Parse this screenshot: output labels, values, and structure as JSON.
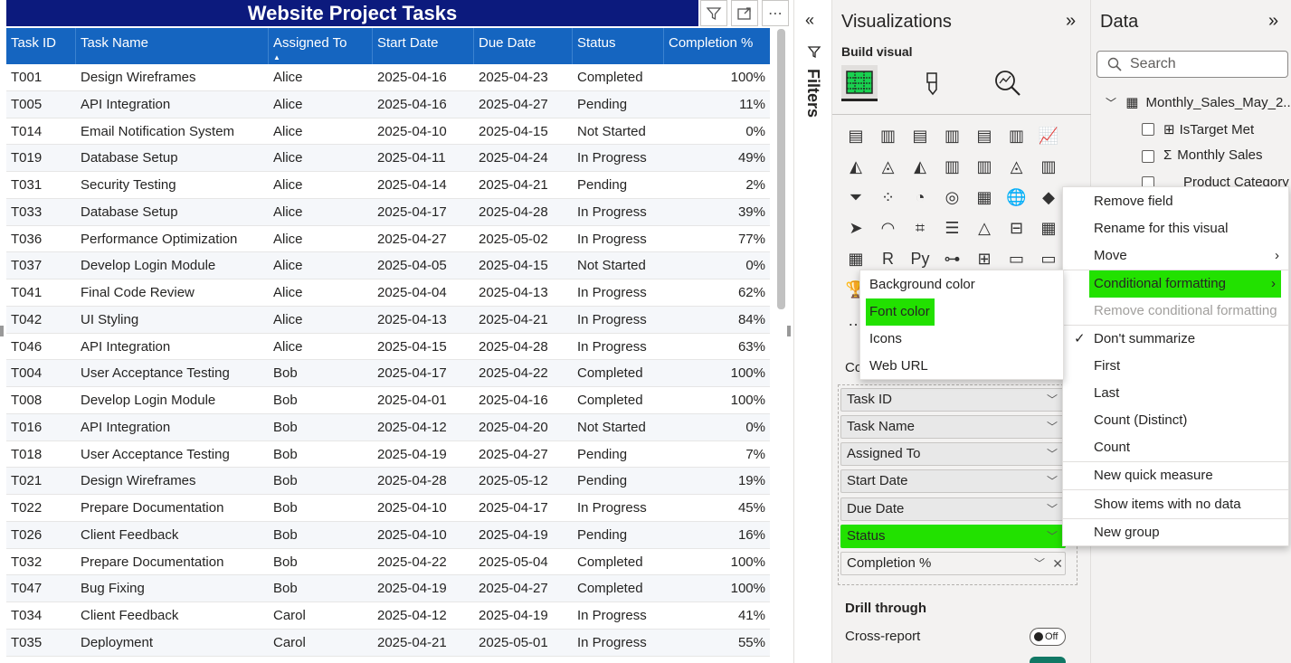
{
  "visual": {
    "title": "Website Project Tasks",
    "columns": [
      "Task ID",
      "Task Name",
      "Assigned To",
      "Start Date",
      "Due Date",
      "Status",
      "Completion %"
    ],
    "rows": [
      [
        "T001",
        "Design Wireframes",
        "Alice",
        "2025-04-16",
        "2025-04-23",
        "Completed",
        "100%"
      ],
      [
        "T005",
        "API Integration",
        "Alice",
        "2025-04-16",
        "2025-04-27",
        "Pending",
        "11%"
      ],
      [
        "T014",
        "Email Notification System",
        "Alice",
        "2025-04-10",
        "2025-04-15",
        "Not Started",
        "0%"
      ],
      [
        "T019",
        "Database Setup",
        "Alice",
        "2025-04-11",
        "2025-04-24",
        "In Progress",
        "49%"
      ],
      [
        "T031",
        "Security Testing",
        "Alice",
        "2025-04-14",
        "2025-04-21",
        "Pending",
        "2%"
      ],
      [
        "T033",
        "Database Setup",
        "Alice",
        "2025-04-17",
        "2025-04-28",
        "In Progress",
        "39%"
      ],
      [
        "T036",
        "Performance Optimization",
        "Alice",
        "2025-04-27",
        "2025-05-02",
        "In Progress",
        "77%"
      ],
      [
        "T037",
        "Develop Login Module",
        "Alice",
        "2025-04-05",
        "2025-04-15",
        "Not Started",
        "0%"
      ],
      [
        "T041",
        "Final Code Review",
        "Alice",
        "2025-04-04",
        "2025-04-13",
        "In Progress",
        "62%"
      ],
      [
        "T042",
        "UI Styling",
        "Alice",
        "2025-04-13",
        "2025-04-21",
        "In Progress",
        "84%"
      ],
      [
        "T046",
        "API Integration",
        "Alice",
        "2025-04-15",
        "2025-04-28",
        "In Progress",
        "63%"
      ],
      [
        "T004",
        "User Acceptance Testing",
        "Bob",
        "2025-04-17",
        "2025-04-22",
        "Completed",
        "100%"
      ],
      [
        "T008",
        "Develop Login Module",
        "Bob",
        "2025-04-01",
        "2025-04-16",
        "Completed",
        "100%"
      ],
      [
        "T016",
        "API Integration",
        "Bob",
        "2025-04-12",
        "2025-04-20",
        "Not Started",
        "0%"
      ],
      [
        "T018",
        "User Acceptance Testing",
        "Bob",
        "2025-04-19",
        "2025-04-27",
        "Pending",
        "7%"
      ],
      [
        "T021",
        "Design Wireframes",
        "Bob",
        "2025-04-28",
        "2025-05-12",
        "Pending",
        "19%"
      ],
      [
        "T022",
        "Prepare Documentation",
        "Bob",
        "2025-04-10",
        "2025-04-17",
        "In Progress",
        "45%"
      ],
      [
        "T026",
        "Client Feedback",
        "Bob",
        "2025-04-10",
        "2025-04-19",
        "Pending",
        "16%"
      ],
      [
        "T032",
        "Prepare Documentation",
        "Bob",
        "2025-04-22",
        "2025-05-04",
        "Completed",
        "100%"
      ],
      [
        "T047",
        "Bug Fixing",
        "Bob",
        "2025-04-19",
        "2025-04-27",
        "Completed",
        "100%"
      ],
      [
        "T034",
        "Client Feedback",
        "Carol",
        "2025-04-12",
        "2025-04-19",
        "In Progress",
        "41%"
      ],
      [
        "T035",
        "Deployment",
        "Carol",
        "2025-04-21",
        "2025-05-01",
        "In Progress",
        "55%"
      ]
    ]
  },
  "filters": {
    "title": "Filters"
  },
  "visualizations": {
    "title": "Visualizations",
    "build_label": "Build visual",
    "columns_label": "Co",
    "fields": [
      "Task ID",
      "Task Name",
      "Assigned To",
      "Start Date",
      "Due Date",
      "Status",
      "Completion %"
    ],
    "drill_through": "Drill through",
    "cross_report": "Cross-report",
    "cross_report_state": "Off"
  },
  "data_pane": {
    "title": "Data",
    "search_placeholder": "Search",
    "table_name": "Monthly_Sales_May_2...",
    "items": [
      "IsTarget Met",
      "Monthly Sales",
      "Product Category"
    ]
  },
  "context_menu": {
    "items": [
      "Remove field",
      "Rename for this visual",
      "Move",
      "Conditional formatting",
      "Remove conditional formatting",
      "Don't summarize",
      "First",
      "Last",
      "Count (Distinct)",
      "Count",
      "New quick measure",
      "Show items with no data",
      "New group"
    ]
  },
  "submenu": {
    "items": [
      "Background color",
      "Font color",
      "Icons",
      "Web URL"
    ]
  },
  "colors": {
    "title_bar": "#0c1a7d",
    "header": "#1565c0",
    "highlight": "#22e100"
  }
}
